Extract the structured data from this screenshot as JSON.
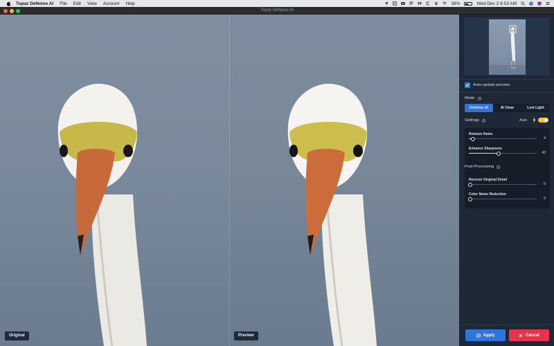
{
  "menubar": {
    "app_name": "Topaz DeNoise AI",
    "menus": [
      "File",
      "Edit",
      "View",
      "Account",
      "Help"
    ],
    "battery": "38%",
    "datetime": "Wed Dec 2  6:53 AM"
  },
  "window": {
    "title": "Topaz DeNoise AI"
  },
  "viewer": {
    "left_label": "Original",
    "right_label": "Preview"
  },
  "panel": {
    "auto_update_label": "Auto-update preview",
    "auto_update_checked": true,
    "mode_title": "Mode",
    "modes": [
      "DeNoise AI",
      "AI Clear",
      "Low Light"
    ],
    "active_mode": "DeNoise AI",
    "settings_title": "Settings",
    "auto_label": "Auto",
    "auto_enabled": true,
    "settings_sliders": [
      {
        "label": "Remove Noise",
        "value": "4",
        "fraction": 0.04
      },
      {
        "label": "Enhance Sharpness",
        "value": "42",
        "fraction": 0.42
      }
    ],
    "post_processing_title": "Post-Processing",
    "post_sliders": [
      {
        "label": "Recover Original Detail",
        "value": "0",
        "fraction": 0.0
      },
      {
        "label": "Color Noise Reduction",
        "value": "0",
        "fraction": 0.0
      }
    ],
    "apply_label": "Apply",
    "cancel_label": "Cancel"
  },
  "colors": {
    "accent": "#2f74db",
    "cancel": "#e8334c",
    "panel_bg": "#1e2836",
    "toggle_on": "#f0c640"
  },
  "icons": [
    "apple-icon",
    "bolt-icon",
    "apply-icon",
    "cancel-x-icon",
    "help-icon",
    "checkmark-icon"
  ]
}
